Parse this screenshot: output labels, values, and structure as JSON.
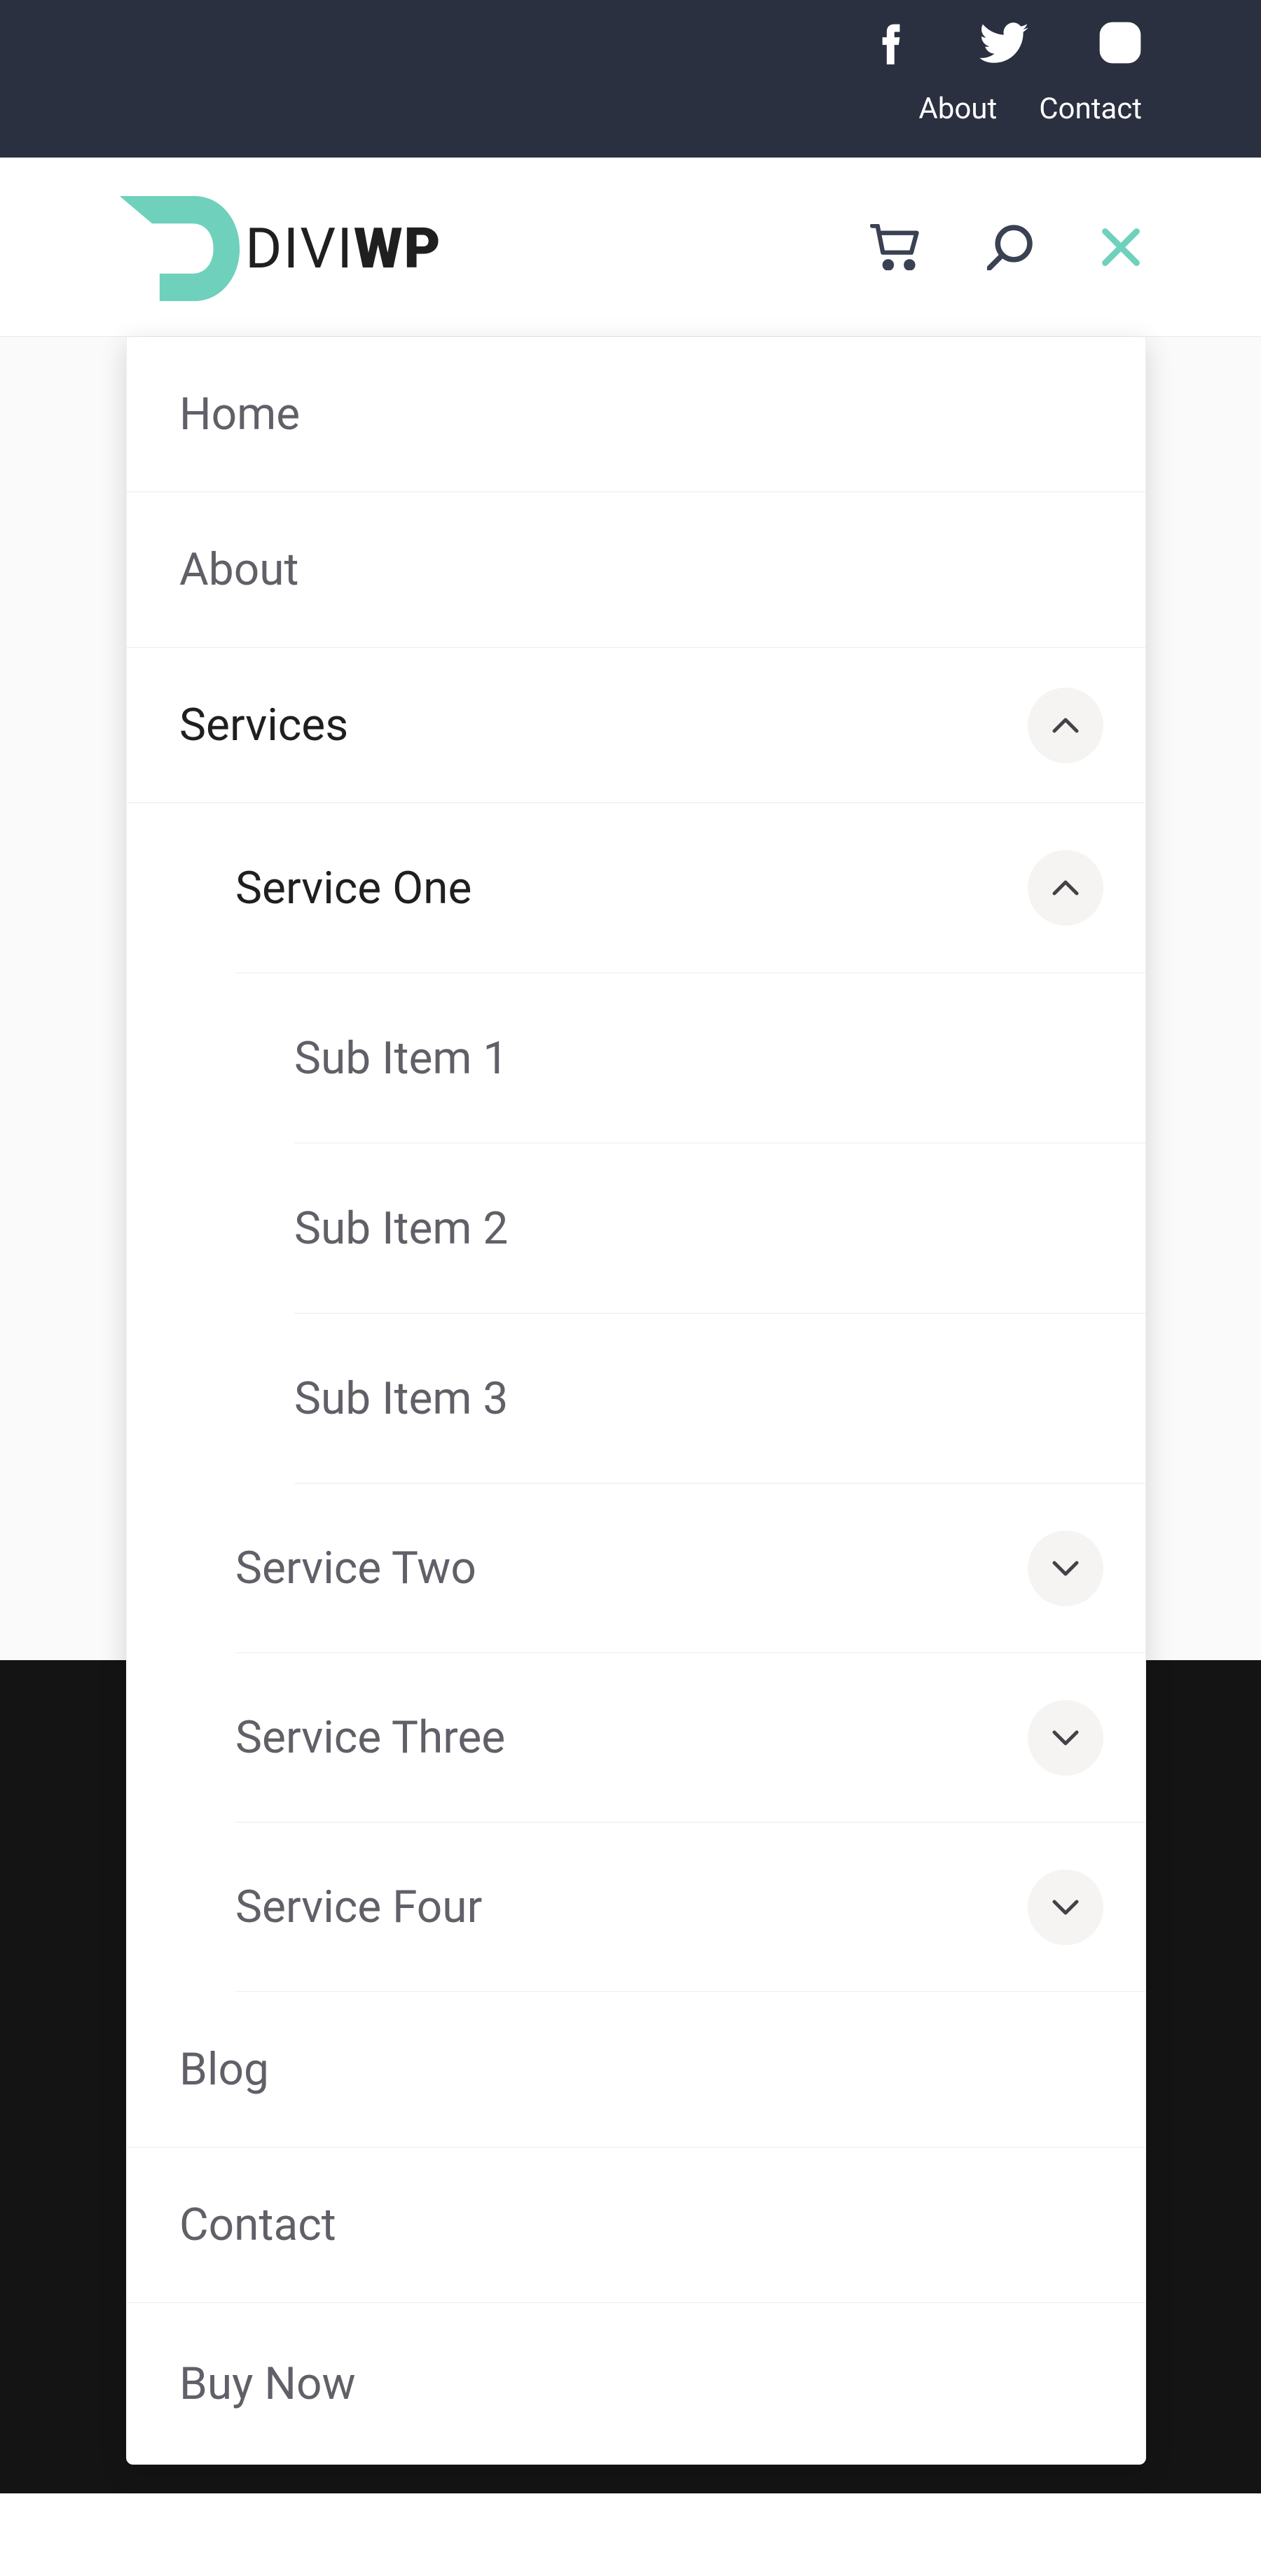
{
  "topbar": {
    "links": {
      "about": "About",
      "contact": "Contact"
    }
  },
  "logo": {
    "part1": "DIVI",
    "part2": "WP"
  },
  "menu": {
    "home": "Home",
    "about": "About",
    "services": {
      "label": "Services",
      "service_one": {
        "label": "Service One",
        "sub1": "Sub Item 1",
        "sub2": "Sub Item 2",
        "sub3": "Sub Item 3"
      },
      "service_two": "Service Two",
      "service_three": "Service Three",
      "service_four": "Service Four"
    },
    "blog": "Blog",
    "contact": "Contact",
    "buy_now": "Buy Now"
  }
}
